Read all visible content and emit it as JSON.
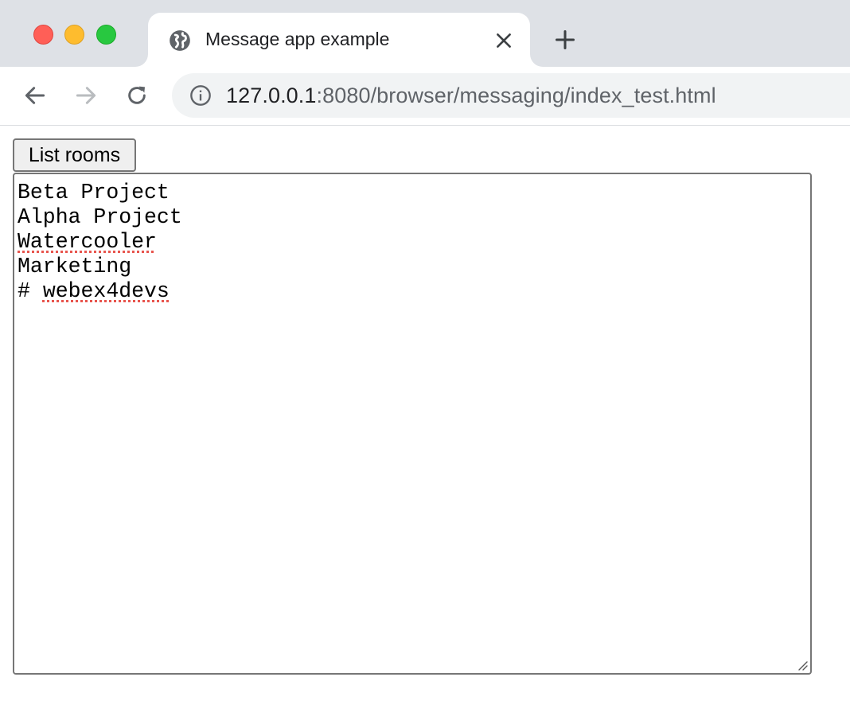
{
  "browser": {
    "tab": {
      "title": "Message app example",
      "favicon": "globe-icon",
      "close_icon": "close-icon"
    },
    "new_tab_icon": "plus-icon",
    "nav": {
      "back_icon": "arrow-left-icon",
      "forward_icon": "arrow-right-icon",
      "reload_icon": "reload-icon"
    },
    "omnibox": {
      "info_icon": "info-icon",
      "url_host": "127.0.0.1",
      "url_rest": ":8080/browser/messaging/index_test.html"
    },
    "traffic_lights": {
      "close_color": "#ff5f57",
      "minimize_color": "#febc2e",
      "maximize_color": "#28c840"
    }
  },
  "page": {
    "list_rooms_label": "List rooms",
    "rooms": [
      {
        "prefix": "",
        "name": "Beta Project",
        "spell_flag": false
      },
      {
        "prefix": "",
        "name": "Alpha Project",
        "spell_flag": false
      },
      {
        "prefix": "",
        "name": "Watercooler",
        "spell_flag": true
      },
      {
        "prefix": "",
        "name": "Marketing",
        "spell_flag": false
      },
      {
        "prefix": "# ",
        "name": "webex4devs",
        "spell_flag": true
      }
    ]
  }
}
